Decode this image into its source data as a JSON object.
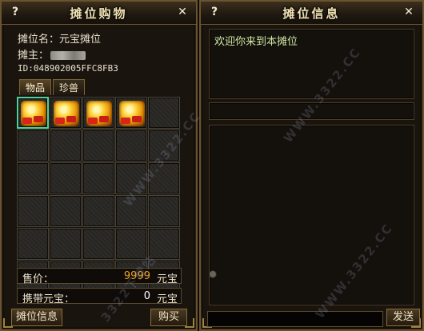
{
  "shop": {
    "title": "摊位购物",
    "help_label": "?",
    "close_label": "✕",
    "stall_name_label": "摊位名：",
    "stall_name": "元宝摊位",
    "owner_label": "摊主：",
    "id_text": "ID:048902005FFC8FB3",
    "tabs": [
      {
        "label": "物品",
        "active": true
      },
      {
        "label": "珍兽",
        "active": false
      }
    ],
    "grid": {
      "rows": 6,
      "cols": 5,
      "filled": 4,
      "selected": 0,
      "item_icon": "gold-ingot-icon"
    },
    "price_label": "售价：",
    "price_value": "9999",
    "price_unit": "元宝",
    "carry_label": "携带元宝：",
    "carry_value": "0",
    "carry_unit": "元宝",
    "stall_info_button": "摊位信息",
    "buy_button": "购买"
  },
  "info": {
    "title": "摊位信息",
    "help_label": "?",
    "close_label": "✕",
    "welcome_text": "欢迎你来到本摊位",
    "send_button": "发送",
    "chat_placeholder": ""
  },
  "watermark_text": "WWW.3322.CC",
  "watermark_text2": "3322下载站",
  "colors": {
    "price_value": "#f0a020",
    "carry_value": "#ffffff",
    "welcome": "#cfe8a4",
    "selected_border": "#4ed19c"
  }
}
